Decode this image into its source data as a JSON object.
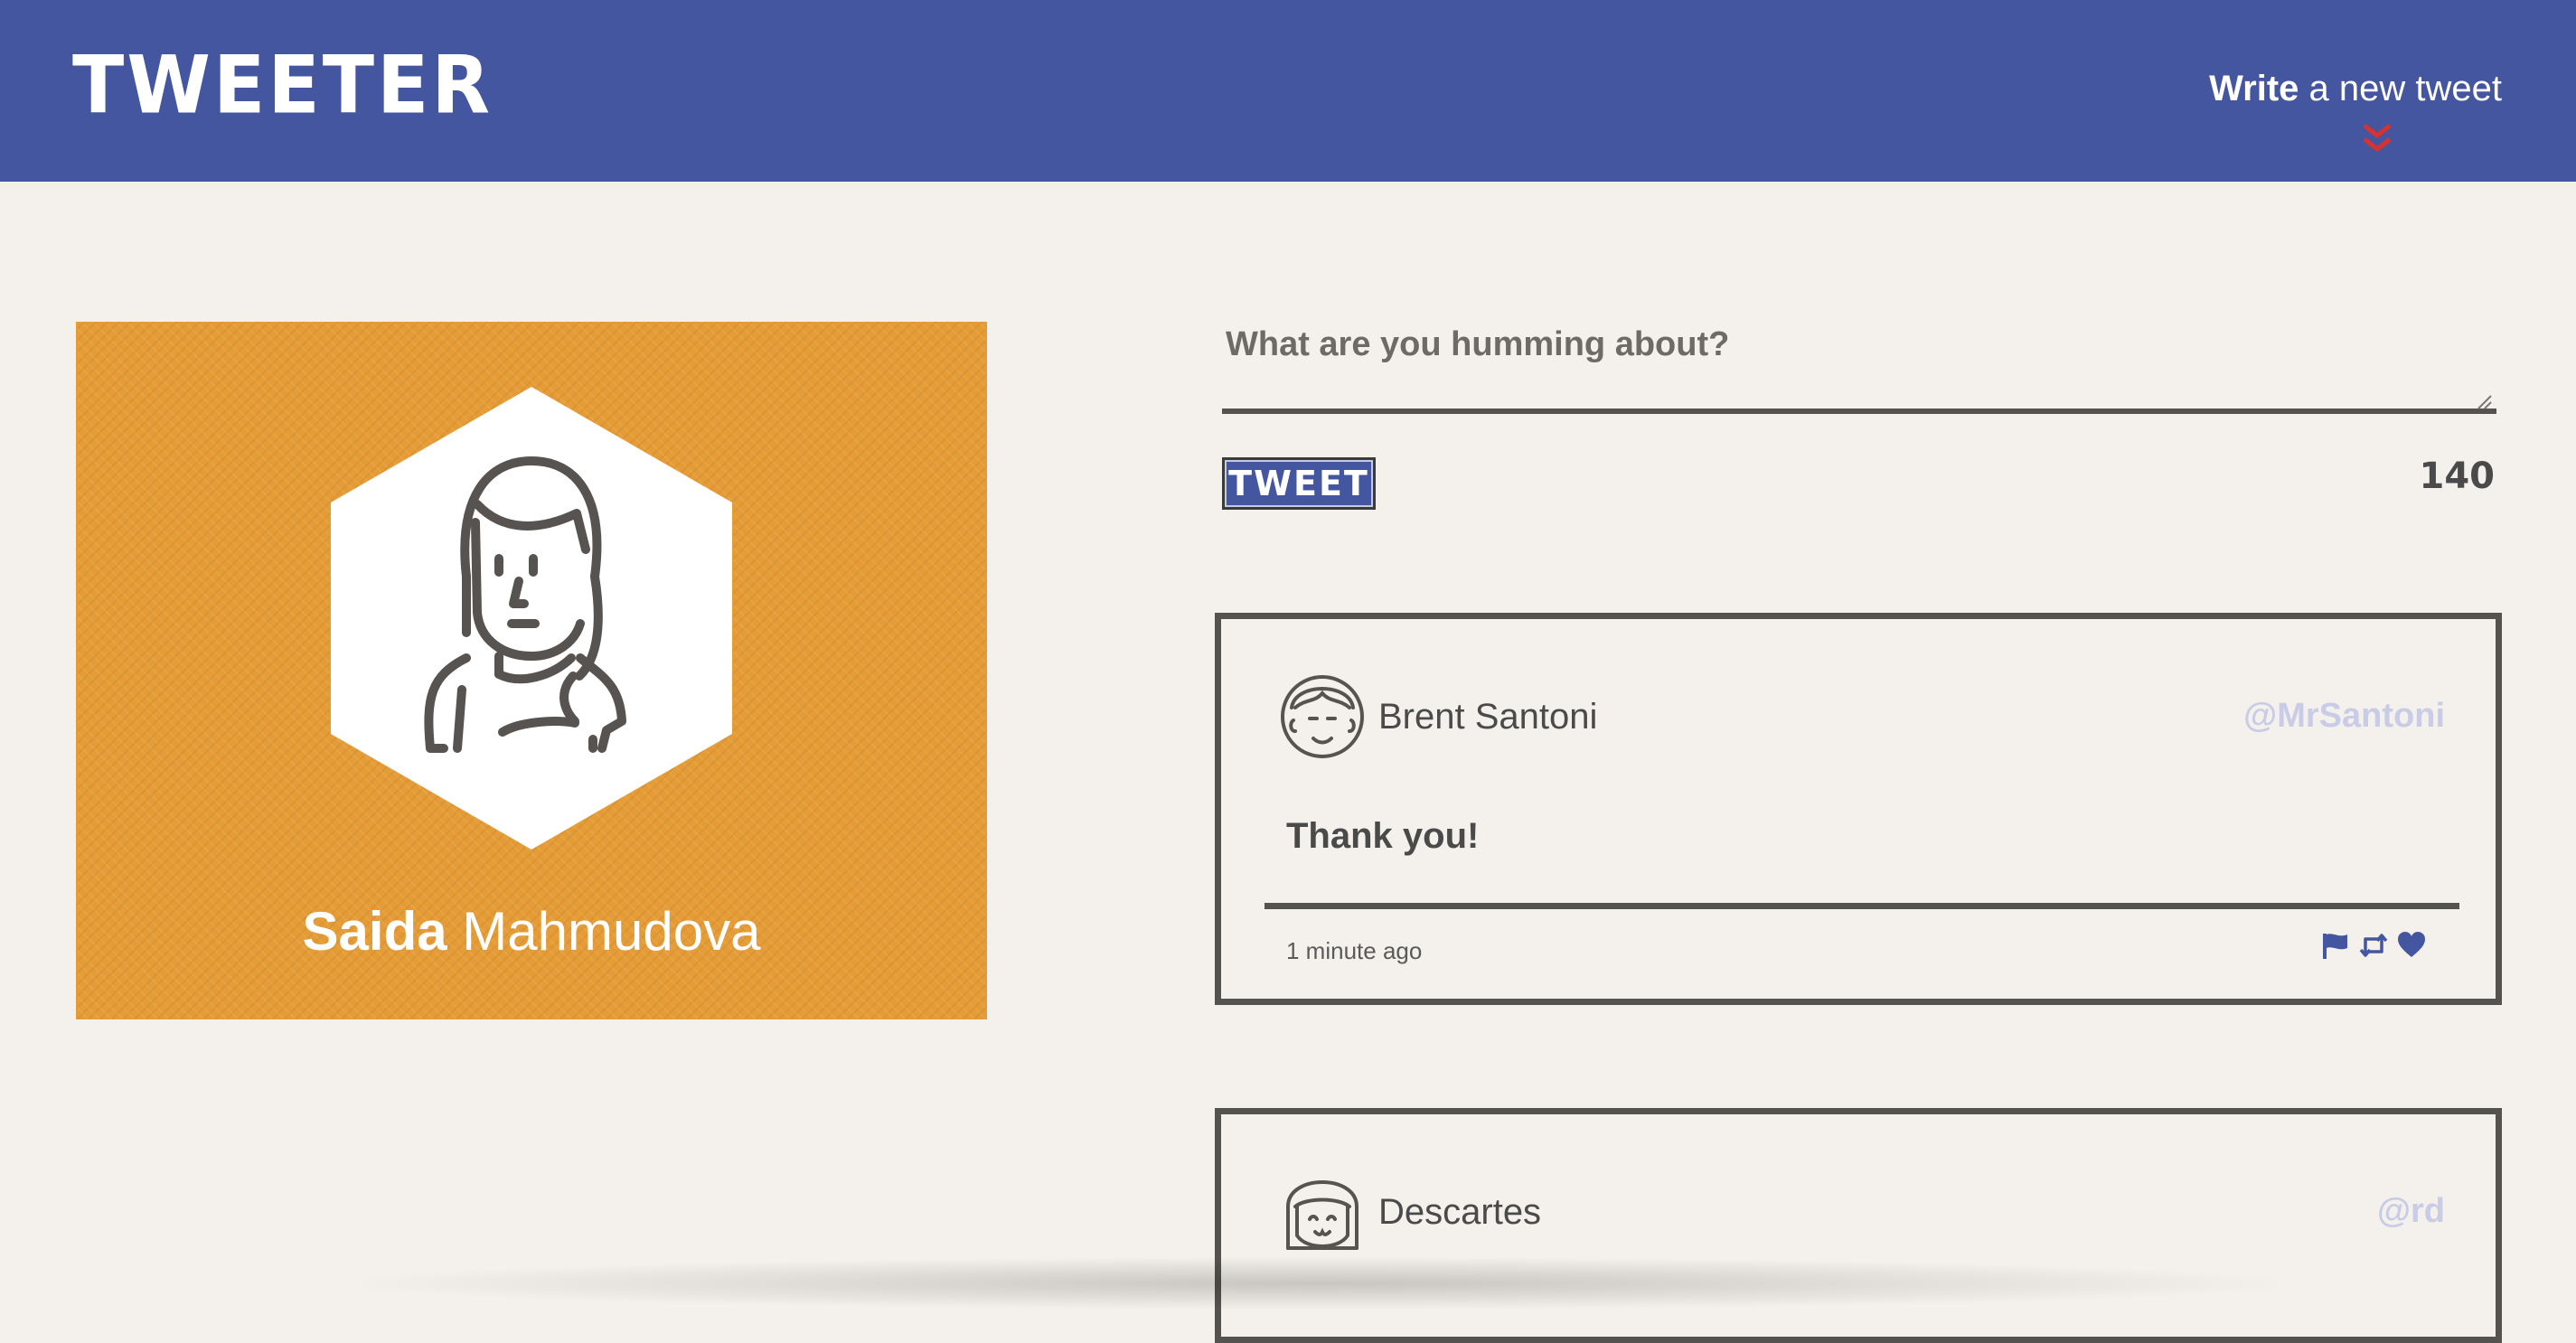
{
  "nav": {
    "brand": "TWEETER",
    "compose_bold": "Write",
    "compose_rest": " a new tweet",
    "compose_icon": "double-chevron-down-icon",
    "accent": "#4556a0",
    "chevron_color": "#d8322e"
  },
  "profile": {
    "first_name": "Saida",
    "last_name": " Mahmudova",
    "background": "#e69c36",
    "avatar_icon": "woman-avatar-icon"
  },
  "composer": {
    "placeholder": "What are you humming about?",
    "button_label": "TWEET",
    "counter": "140"
  },
  "tweets": [
    {
      "name": "Brent Santoni",
      "handle": "@MrSantoni",
      "content": "Thank you!",
      "time": "1 minute ago",
      "avatar_icon": "man-avatar-icon",
      "actions": [
        "flag-icon",
        "retweet-icon",
        "heart-icon"
      ]
    },
    {
      "name": "Descartes",
      "handle": "@rd",
      "avatar_icon": "girl-avatar-icon"
    }
  ]
}
